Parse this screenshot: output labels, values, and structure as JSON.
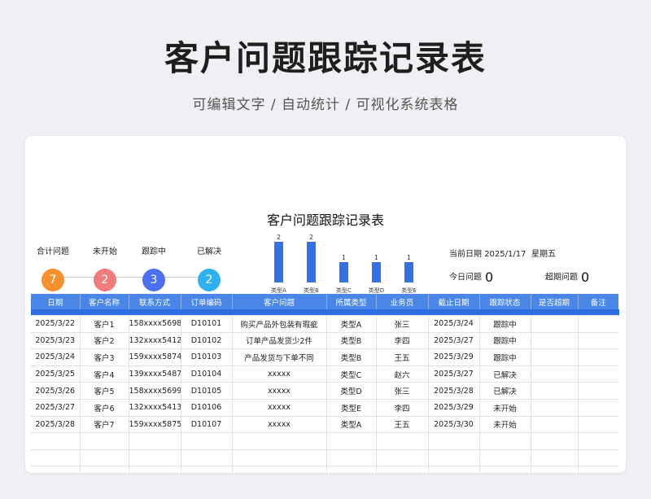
{
  "page": {
    "title": "客户问题跟踪记录表",
    "subtitle": "可编辑文字 / 自动统计 / 可视化系统表格"
  },
  "sheet": {
    "title": "客户问题跟踪记录表",
    "stats": [
      {
        "label": "合计问题",
        "value": "7",
        "color": "#f5922e"
      },
      {
        "label": "未开始",
        "value": "2",
        "color": "#ef7b7b"
      },
      {
        "label": "跟踪中",
        "value": "3",
        "color": "#4c6ff0"
      },
      {
        "label": "已解决",
        "value": "2",
        "color": "#2fb0f0"
      }
    ],
    "info": {
      "date_label": "当前日期",
      "date_value": "2025/1/17",
      "weekday": "星期五",
      "today_label": "今日问题",
      "today_value": "0",
      "overdue_label": "超期问题",
      "overdue_value": "0"
    }
  },
  "chart_data": {
    "type": "bar",
    "categories": [
      "类型A",
      "类型B",
      "类型C",
      "类型D",
      "类型E"
    ],
    "values": [
      2,
      2,
      1,
      1,
      1
    ],
    "color": "#3571e6",
    "ylim": [
      0,
      2
    ]
  },
  "table": {
    "headers": [
      "日期",
      "客户名称",
      "联系方式",
      "订单编码",
      "客户问题",
      "所属类型",
      "业务员",
      "截止日期",
      "跟踪状态",
      "是否超期",
      "备注"
    ],
    "rows": [
      [
        "2025/3/22",
        "客户1",
        "158xxxx5698",
        "D10101",
        "购买产品外包装有瑕疵",
        "类型A",
        "张三",
        "2025/3/24",
        "跟踪中",
        "",
        ""
      ],
      [
        "2025/3/23",
        "客户2",
        "132xxxx5412",
        "D10102",
        "订单产品发货少2件",
        "类型B",
        "李四",
        "2025/3/27",
        "跟踪中",
        "",
        ""
      ],
      [
        "2025/3/24",
        "客户3",
        "159xxxx5874",
        "D10103",
        "产品发货与下单不同",
        "类型B",
        "王五",
        "2025/3/29",
        "跟踪中",
        "",
        ""
      ],
      [
        "2025/3/25",
        "客户4",
        "139xxxx5487",
        "D10104",
        "xxxxx",
        "类型C",
        "赵六",
        "2025/3/27",
        "已解决",
        "",
        ""
      ],
      [
        "2025/3/26",
        "客户5",
        "158xxxx5699",
        "D10105",
        "xxxxx",
        "类型D",
        "张三",
        "2025/3/28",
        "已解决",
        "",
        ""
      ],
      [
        "2025/3/27",
        "客户6",
        "132xxxx5413",
        "D10106",
        "xxxxx",
        "类型E",
        "李四",
        "2025/3/29",
        "未开始",
        "",
        ""
      ],
      [
        "2025/3/28",
        "客户7",
        "159xxxx5875",
        "D10107",
        "xxxxx",
        "类型A",
        "王五",
        "2025/3/30",
        "未开始",
        "",
        ""
      ],
      [
        "",
        "",
        "",
        "",
        "",
        "",
        "",
        "",
        "",
        "",
        ""
      ],
      [
        "",
        "",
        "",
        "",
        "",
        "",
        "",
        "",
        "",
        "",
        ""
      ],
      [
        "",
        "",
        "",
        "",
        "",
        "",
        "",
        "",
        "",
        "",
        ""
      ]
    ]
  }
}
